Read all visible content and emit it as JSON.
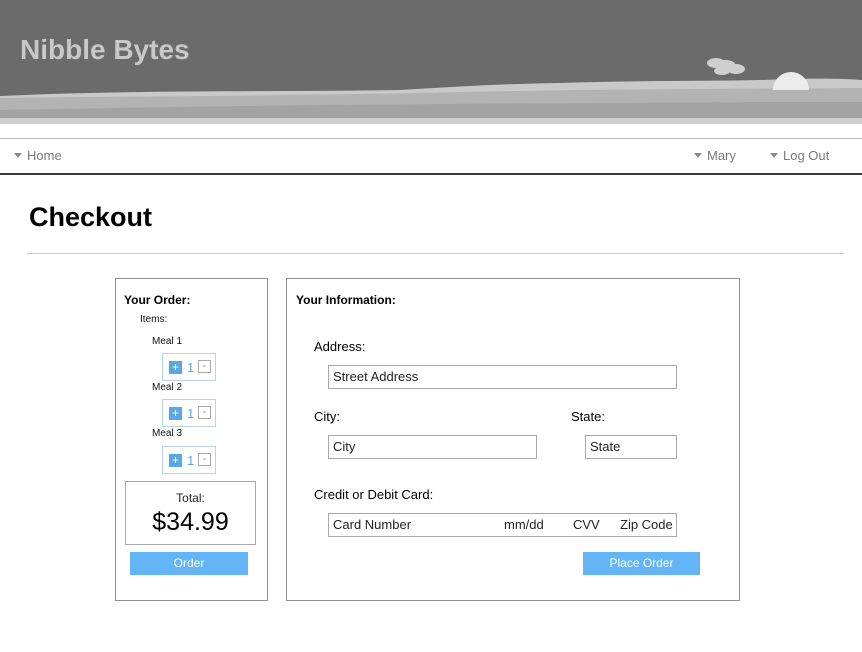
{
  "app": {
    "title": "Nibble Bytes"
  },
  "nav": {
    "home": "Home",
    "user": "Mary",
    "logout": "Log Out"
  },
  "page": {
    "title": "Checkout"
  },
  "order": {
    "heading": "Your Order:",
    "items_label": "Items:",
    "items": [
      {
        "name": "Meal 1",
        "qty": "1",
        "plus": "+",
        "minus": "-"
      },
      {
        "name": "Meal 2",
        "qty": "1",
        "plus": "+",
        "minus": "-"
      },
      {
        "name": "Meal 3",
        "qty": "1",
        "plus": "+",
        "minus": "-"
      }
    ],
    "total_label": "Total:",
    "total_value": "$34.99",
    "order_button": "Order"
  },
  "info": {
    "heading": "Your Information:",
    "address_label": "Address:",
    "street_placeholder": "Street Address",
    "city_label": "City:",
    "city_placeholder": "City",
    "state_label": "State:",
    "state_placeholder": "State",
    "card_label": "Credit or Debit Card:",
    "card_number": "Card Number",
    "card_date": "mm/dd",
    "card_cvv": "CVV",
    "card_zip": "Zip Code",
    "place_order_button": "Place Order"
  },
  "colors": {
    "banner": "#6b6b6c",
    "accent": "#64b5f7",
    "title_text": "#c8c8c8"
  }
}
